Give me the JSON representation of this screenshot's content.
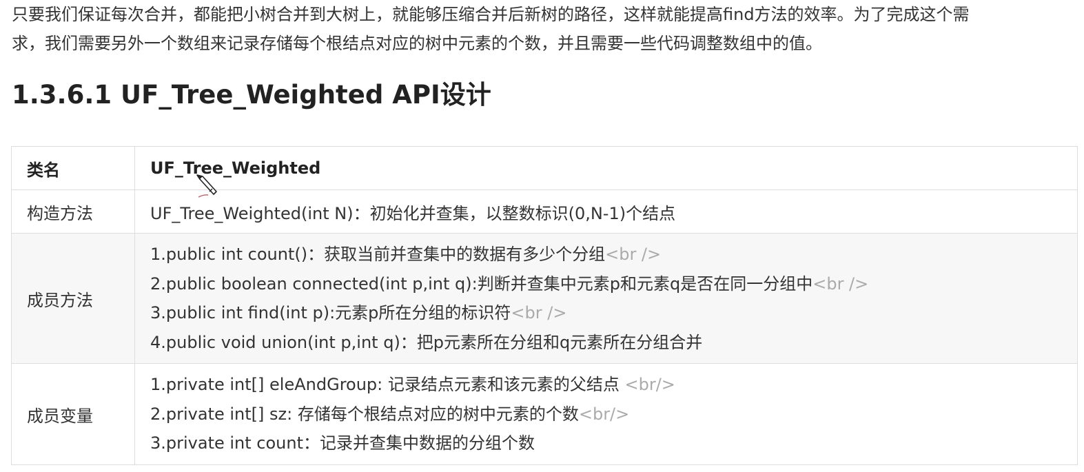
{
  "intro": {
    "line1": "只要我们保证每次合并，都能把小树合并到大树上，就能够压缩合并后新树的路径，这样就能提高find方法的效率。为了完成这个需",
    "line2": "求，我们需要另外一个数组来记录存储每个根结点对应的树中元素的个数，并且需要一些代码调整数组中的值。"
  },
  "heading": "1.3.6.1 UF_Tree_Weighted API设计",
  "table": {
    "class_label": "类名",
    "class_name": "UF_Tree_Weighted",
    "ctor_label": "构造方法",
    "ctor_value": "UF_Tree_Weighted(int N)：初始化并查集，以整数标识(0,N-1)个结点",
    "methods_label": "成员方法",
    "methods": [
      {
        "text": "1.public int count()：获取当前并查集中的数据有多少个分组",
        "tag": "<br />"
      },
      {
        "text": "2.public boolean connected(int p,int q):判断并查集中元素p和元素q是否在同一分组中",
        "tag": "<br />"
      },
      {
        "text": "3.public int find(int p):元素p所在分组的标识符",
        "tag": "<br />"
      },
      {
        "text": "4.public void union(int p,int q)：把p元素所在分组和q元素所在分组合并",
        "tag": ""
      }
    ],
    "fields_label": "成员变量",
    "fields": [
      {
        "text": "1.private int[]  eleAndGroup: 记录结点元素和该元素的父结点 ",
        "tag": "<br/>"
      },
      {
        "text": "2.private int[] sz: 存储每个根结点对应的树中元素的个数",
        "tag": "<br/>"
      },
      {
        "text": "3.private int count：记录并查集中数据的分组个数",
        "tag": ""
      }
    ]
  },
  "cursor_icon": "pencil-cursor-icon"
}
